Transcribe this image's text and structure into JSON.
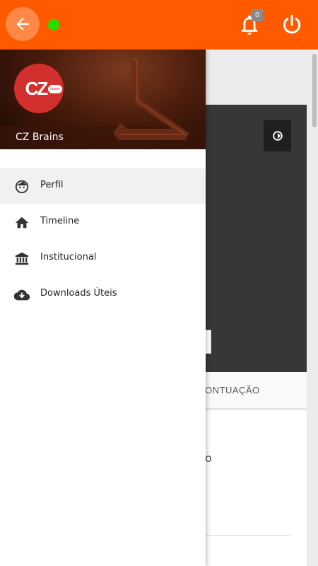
{
  "appbar": {
    "back_icon": "arrow-left-icon",
    "status_color": "#22e000",
    "notification_count": "0",
    "bell_icon": "bell-icon",
    "power_icon": "power-icon",
    "accent": "#ff5a00"
  },
  "drawer": {
    "header": {
      "avatar_text": "CZ",
      "avatar_badge": "brains",
      "title": "CZ Brains"
    },
    "items": [
      {
        "label": "Perfil",
        "icon": "face-icon",
        "active": true
      },
      {
        "label": "Timeline",
        "icon": "home-icon",
        "active": false
      },
      {
        "label": "Institucional",
        "icon": "bank-icon",
        "active": false
      },
      {
        "label": "Downloads Úteis",
        "icon": "cloud-download-icon",
        "active": false
      }
    ]
  },
  "background": {
    "tab_label": "ONTUAÇÃO",
    "content_fragment": "o"
  }
}
